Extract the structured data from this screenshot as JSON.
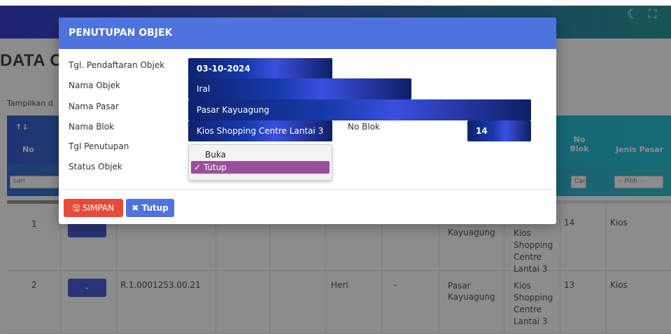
{
  "header": {
    "theme_icon": "moon-icon",
    "fullscreen_icon": "fullscreen-icon"
  },
  "page": {
    "title": "DATA OBJEK",
    "show_entries": "Tampilkan d"
  },
  "table": {
    "headers": {
      "no": "No",
      "no_blok": "No Blok",
      "jenis_pasar": "Jenis Pasar"
    },
    "filter_placeholder": "cari",
    "filter_cari_small": "Cari",
    "filter_pilih": "-- Pilih --",
    "rows": [
      {
        "no": "1",
        "pasar": "Kayuagung",
        "blok": "Kios Shopping Centre Lantai 3",
        "no_blok": "14",
        "jenis": "Kios",
        "action": ""
      },
      {
        "no": "2",
        "kode": "R.1.0001253.00.21",
        "nama": "Heri",
        "dash": "-",
        "pasar": "Pasar Kayuagung",
        "blok": "Kios Shopping Centre Lantai 3",
        "no_blok": "13",
        "jenis": "Kios",
        "action": "⌄"
      }
    ]
  },
  "modal": {
    "title": "PENUTUPAN OBJEK",
    "labels": {
      "tgl_pendaftaran": "Tgl. Pendaftaran Objek",
      "nama_objek": "Nama Objek",
      "nama_pasar": "Nama Pasar",
      "nama_blok": "Nama Blok",
      "tgl_penutupan": "Tgl Penutupan",
      "status_objek": "Status Objek",
      "no_blok": "No Blok"
    },
    "values": {
      "tgl_pendaftaran": "03-10-2024",
      "nama_objek": "Iral",
      "nama_pasar": "Pasar Kayuagung",
      "nama_blok": "Kios Shopping Centre Lantai 3",
      "no_blok": "14"
    },
    "status_options": [
      "Buka",
      "✓ Tutup"
    ],
    "selected_status": "Tutup",
    "buttons": {
      "save": "SIMPAN",
      "close": "Tutup"
    },
    "colors": {
      "header": "#4e73df",
      "save": "#e74a3b",
      "close": "#4e73df",
      "selected_option": "#9a4f9d"
    }
  }
}
